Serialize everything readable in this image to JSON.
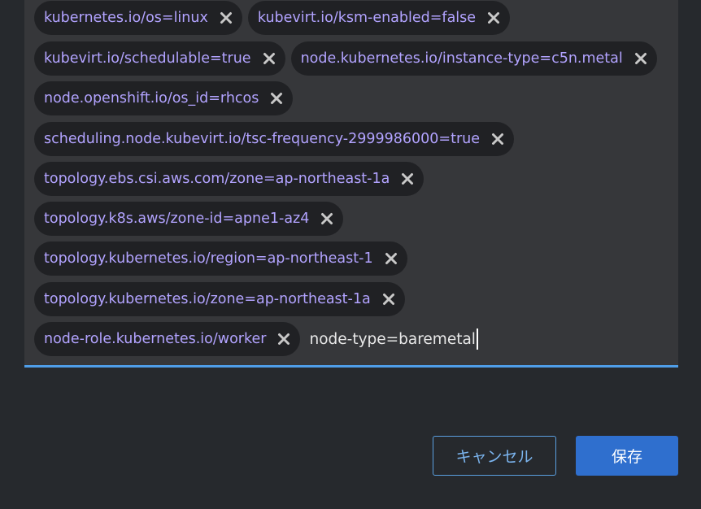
{
  "labels": {
    "chips": [
      "kubernetes.io/os=linux",
      "kubevirt.io/ksm-enabled=false",
      "kubevirt.io/schedulable=true",
      "node.kubernetes.io/instance-type=c5n.metal",
      "node.openshift.io/os_id=rhcos",
      "scheduling.node.kubevirt.io/tsc-frequency-2999986000=true",
      "topology.ebs.csi.aws.com/zone=ap-northeast-1a",
      "topology.k8s.aws/zone-id=apne1-az4",
      "topology.kubernetes.io/region=ap-northeast-1",
      "topology.kubernetes.io/zone=ap-northeast-1a",
      "node-role.kubernetes.io/worker"
    ],
    "input_value": "node-type=baremetal",
    "remove_icon": "close-icon"
  },
  "footer": {
    "cancel_label": "キャンセル",
    "save_label": "保存"
  },
  "colors": {
    "chip_text": "#b2a3ff",
    "chip_bg": "#202124",
    "input_bg": "#36373a",
    "focus_border": "#4f9ee8",
    "primary": "#2f6fce"
  }
}
